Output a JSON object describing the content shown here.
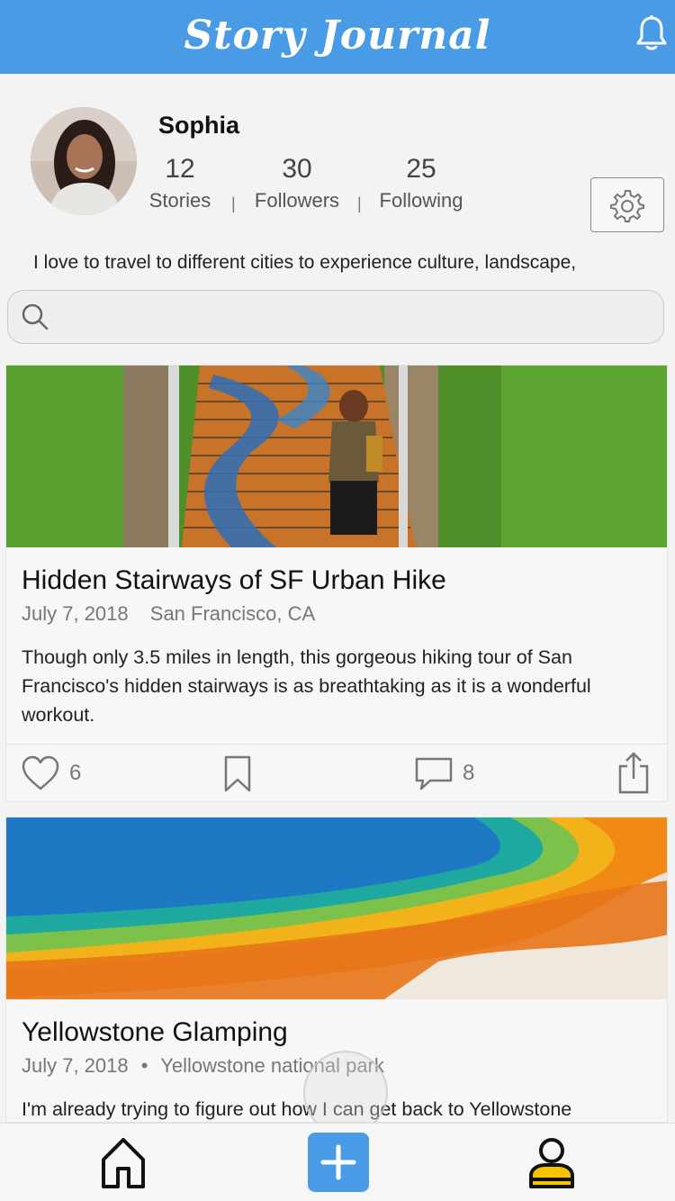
{
  "header": {
    "brand": "Story Journal",
    "bell_icon": "bell-icon"
  },
  "profile": {
    "name": "Sophia",
    "stats": [
      {
        "value": "12",
        "label": "Stories"
      },
      {
        "value": "30",
        "label": "Followers"
      },
      {
        "value": "25",
        "label": "Following"
      }
    ],
    "separator": "|",
    "bio": "I love to travel to different cities to experience culture, landscape,"
  },
  "search": {
    "placeholder": ""
  },
  "stories": [
    {
      "title": "Hidden Stairways of SF Urban Hike",
      "date": "July 7, 2018",
      "location": "San Francisco, CA",
      "description": "Though only 3.5 miles in length, this gorgeous hiking tour of San Francisco's hidden stairways is as breathtaking as it is a wonderful workout.",
      "likes": "6",
      "comments": "8"
    },
    {
      "title": "Yellowstone Glamping",
      "date": "July 7, 2018",
      "meta_separator": "•",
      "location": "Yellowstone national park",
      "description": "I'm already trying to figure out how I can get back to Yellowstone"
    }
  ],
  "colors": {
    "primary": "#4a9be6",
    "accent": "#f5c400"
  },
  "tabbar": {
    "icons": [
      "home-icon",
      "plus-icon",
      "profile-icon"
    ]
  }
}
